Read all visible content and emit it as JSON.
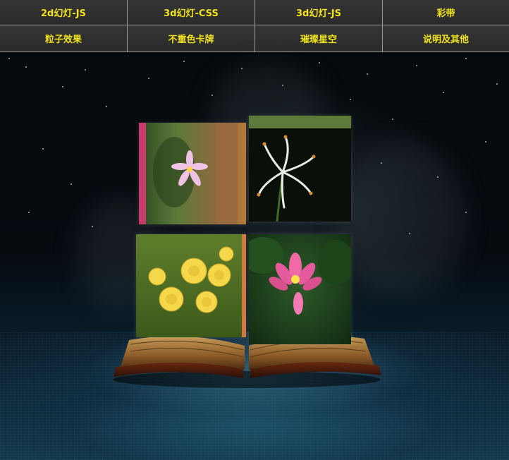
{
  "nav": {
    "row1": [
      "2d幻灯-JS",
      "3d幻灯-CSS",
      "3d幻灯-JS",
      "彩带"
    ],
    "row2": [
      "粒子效果",
      "不重色卡牌",
      "璀璨星空",
      "说明及其他"
    ]
  },
  "colors": {
    "nav_text": "#f2e21a",
    "nav_bg": "#2e2e2e",
    "background": "#05080b",
    "floor_glow": "#286e8c"
  },
  "scene": {
    "tiles": [
      {
        "name": "tile-pink-star-flower",
        "subject": "pink star flower"
      },
      {
        "name": "tile-white-spider-lily",
        "subject": "white spider lily"
      },
      {
        "name": "tile-yellow-roses",
        "subject": "yellow roses"
      },
      {
        "name": "tile-pink-lotus",
        "subject": "pink lotus"
      }
    ]
  }
}
